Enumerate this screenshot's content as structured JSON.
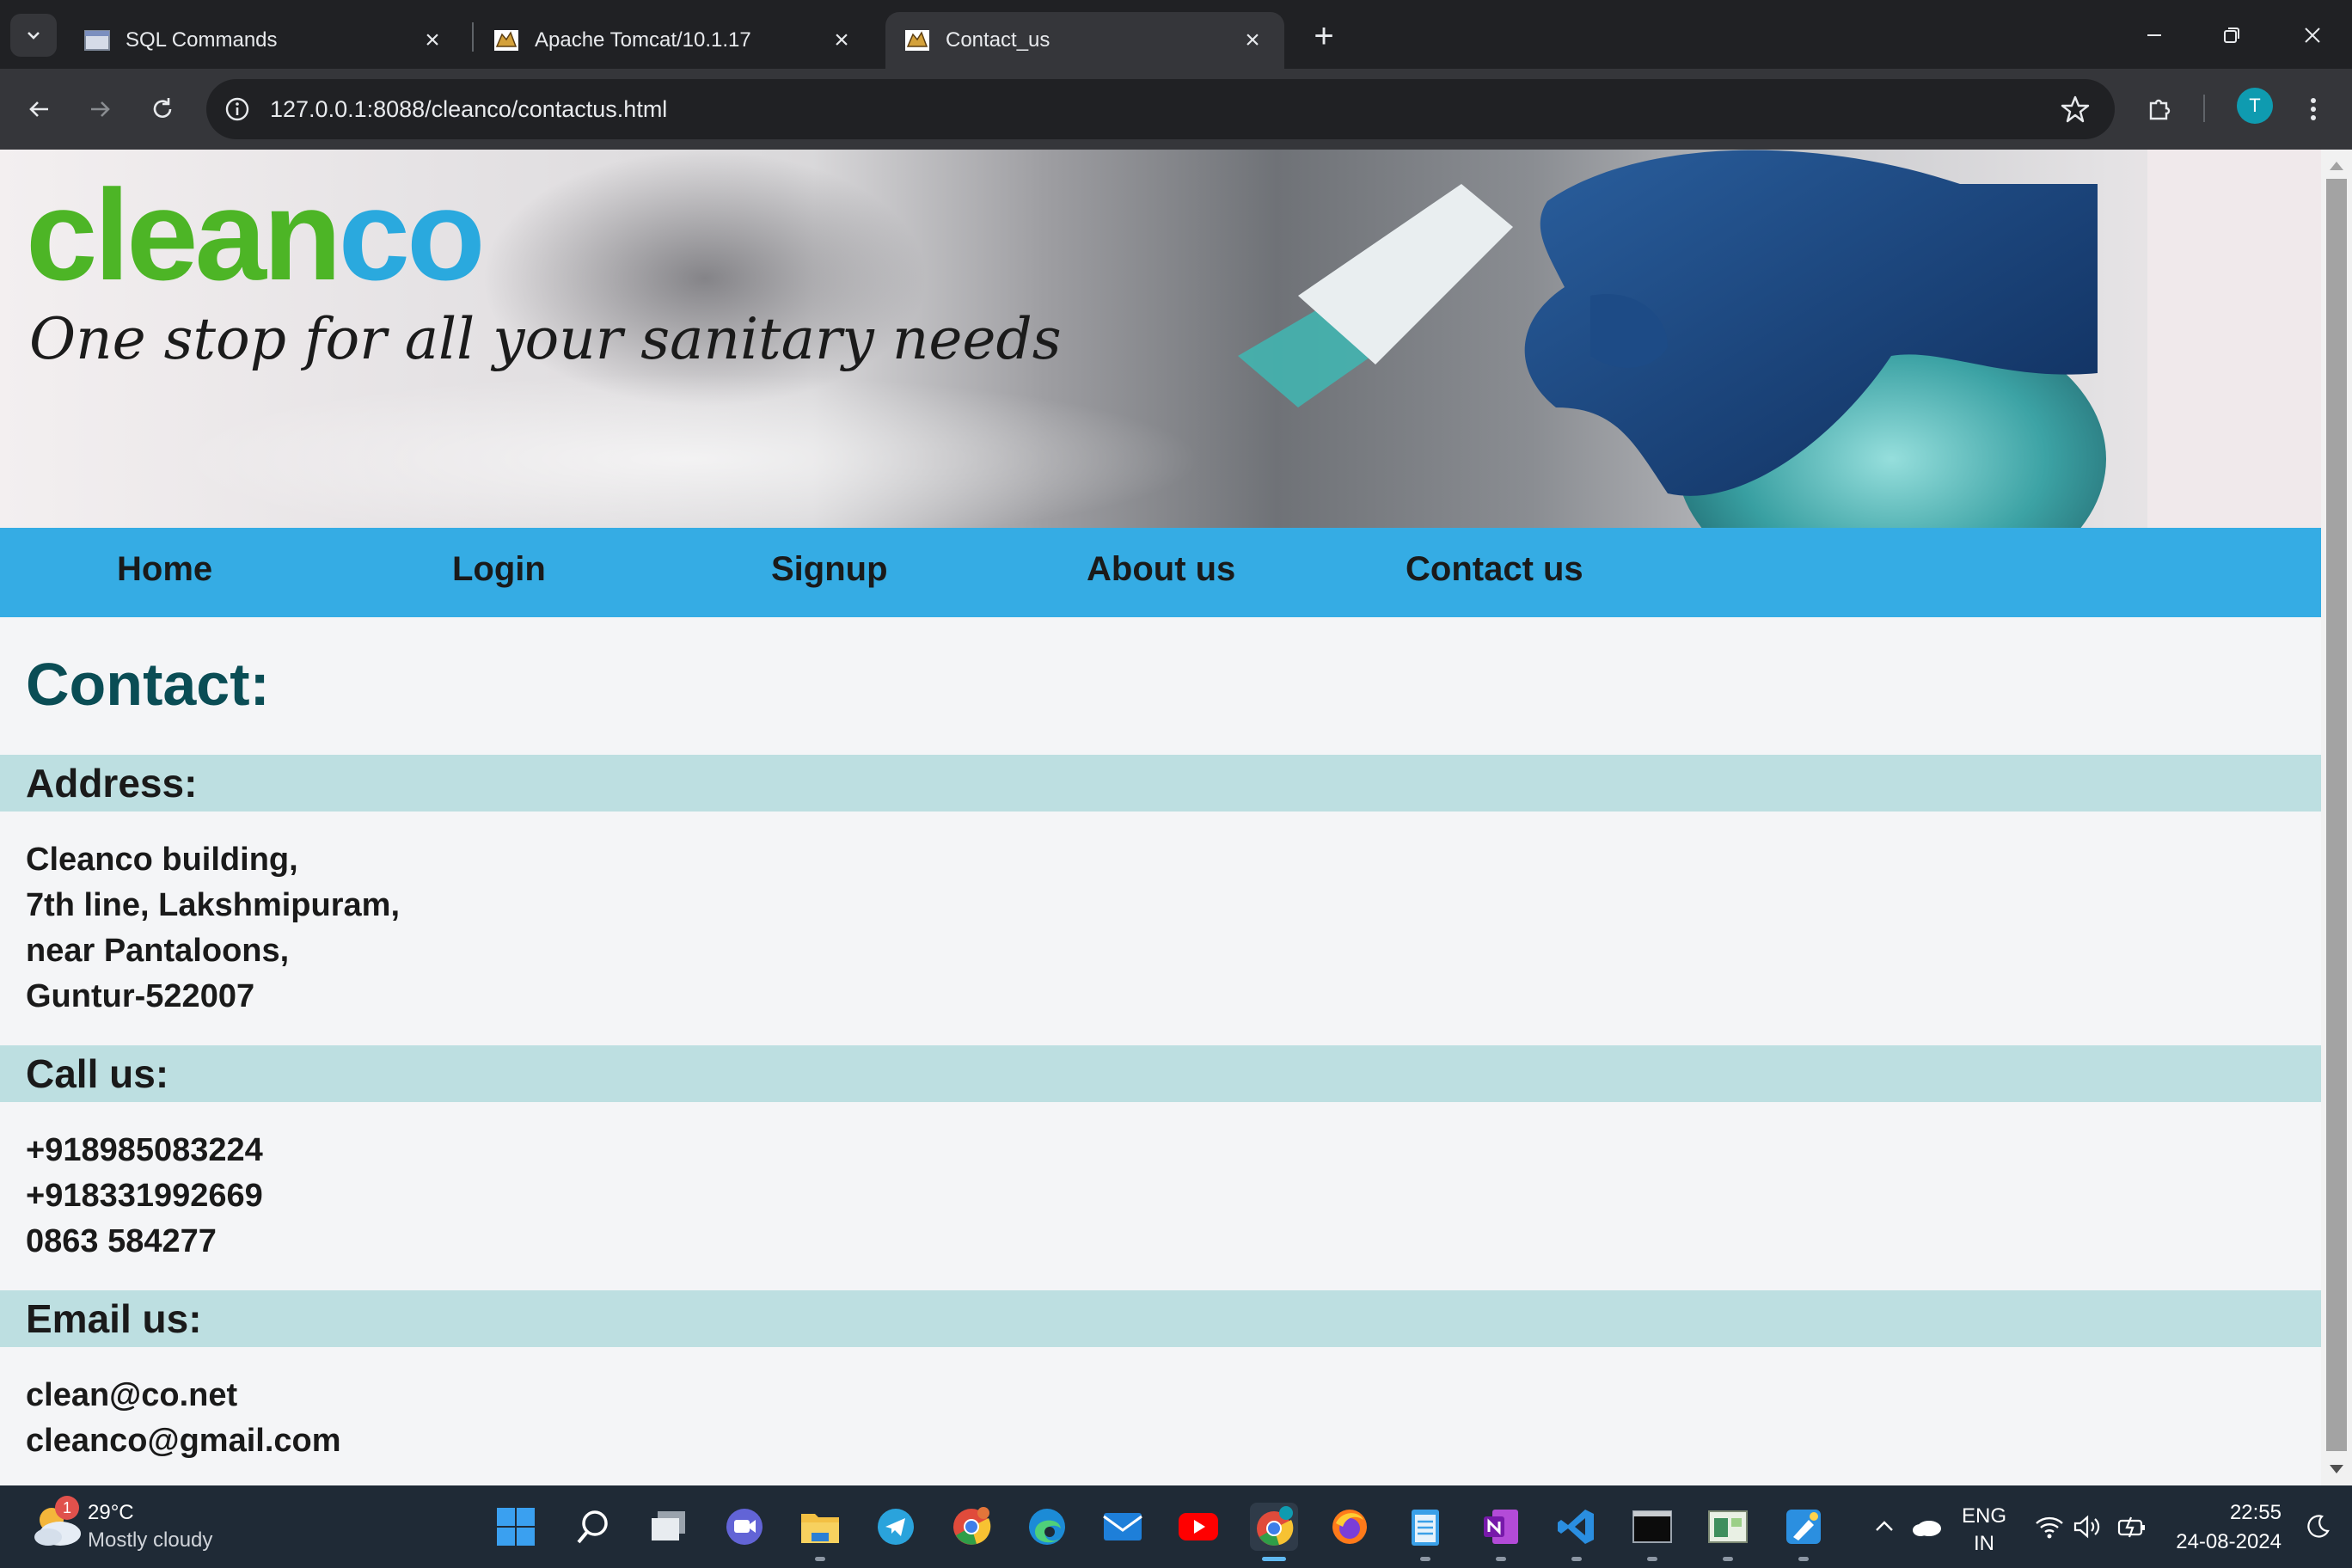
{
  "browser": {
    "tabs": [
      {
        "title": "SQL Commands",
        "active": false
      },
      {
        "title": "Apache Tomcat/10.1.17",
        "active": false
      },
      {
        "title": "Contact_us",
        "active": true
      }
    ],
    "url": "127.0.0.1:8088/cleanco/contactus.html",
    "profile_initial": "T"
  },
  "page": {
    "brand": {
      "part1": "clean",
      "part2": "co",
      "color_part1": "#4db526",
      "color_part2": "#2aa9de"
    },
    "tagline": "One stop for all your sanitary needs",
    "nav": [
      {
        "label": "Home"
      },
      {
        "label": "Login"
      },
      {
        "label": "Signup"
      },
      {
        "label": "About us"
      },
      {
        "label": "Contact us"
      }
    ],
    "contact_title": "Contact:",
    "sections": {
      "address": {
        "heading": "Address:",
        "lines": [
          "Cleanco building,",
          "7th line, Lakshmipuram,",
          "near Pantaloons,",
          "Guntur-522007"
        ]
      },
      "call": {
        "heading": "Call us:",
        "lines": [
          "+918985083224",
          "+918331992669",
          "0863 584277"
        ]
      },
      "email": {
        "heading": "Email us:",
        "lines": [
          "clean@co.net",
          "cleanco@gmail.com"
        ]
      }
    },
    "colors": {
      "nav_bg": "#35ace4",
      "section_bg": "#bddfe1",
      "title": "#0a4d55"
    }
  },
  "taskbar": {
    "weather": {
      "badge": "1",
      "temp": "29°C",
      "desc": "Mostly cloudy"
    },
    "apps": [
      "start-icon",
      "search-icon",
      "task-view-icon",
      "meet-icon",
      "file-explorer-icon",
      "telegram-icon",
      "chrome-profile-icon",
      "edge-icon",
      "mail-icon",
      "youtube-icon",
      "chrome-icon",
      "firefox-icon",
      "notepad-icon",
      "onenote-icon",
      "vscode-icon",
      "terminal-icon",
      "notepad-plus-icon",
      "paint-icon"
    ],
    "tray": {
      "lang1": "ENG",
      "lang2": "IN",
      "time": "22:55",
      "date": "24-08-2024"
    }
  }
}
